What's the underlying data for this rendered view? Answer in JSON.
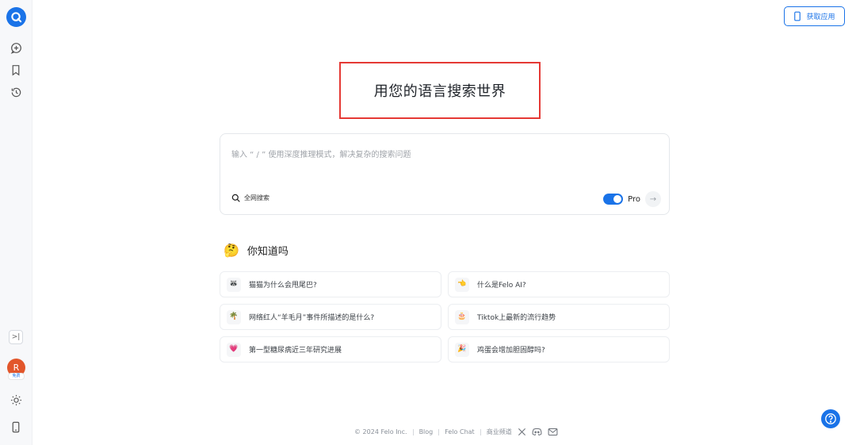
{
  "header": {
    "get_app_label": "获取应用"
  },
  "main": {
    "title": "用您的语言搜索世界"
  },
  "search": {
    "placeholder": "输入 “ / ” 使用深度推理模式，解决复杂的搜索问题",
    "value": "",
    "scope_label": "全网搜索",
    "pro_label": "Pro",
    "pro_enabled": true
  },
  "did_you_know": {
    "emoji": "🤔",
    "title": "你知道吗",
    "items": [
      {
        "emoji": "🦝",
        "text": "猫猫为什么会甩尾巴?"
      },
      {
        "emoji": "👈",
        "text": "什么是Felo AI?"
      },
      {
        "emoji": "🌴",
        "text": "网络红人“羊毛月”事件所描述的是什么?"
      },
      {
        "emoji": "🎂",
        "text": "Tiktok上最新的流行趋势"
      },
      {
        "emoji": "💗",
        "text": "第一型糖尿病近三年研究进展"
      },
      {
        "emoji": "🎉",
        "text": "鸡蛋会增加胆固醇吗?"
      }
    ]
  },
  "sidebar": {
    "avatar_initial": "R",
    "avatar_badge": "免费",
    "collapse_label": ">|"
  },
  "footer": {
    "copyright": "© 2024 Felo Inc.",
    "blog": "Blog",
    "felo_chat": "Felo Chat",
    "business": "商业频道"
  },
  "colors": {
    "accent": "#1a73e8",
    "highlight_border": "#e53935",
    "avatar_bg": "#e2562b"
  }
}
